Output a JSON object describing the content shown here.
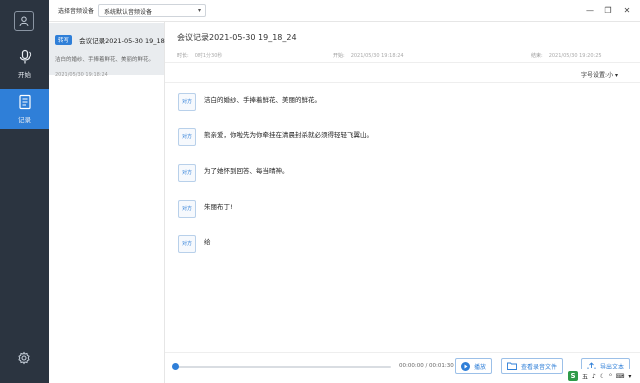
{
  "topbar": {
    "device_label": "选择音频设备",
    "device_value": "系统默认音频设备",
    "window_controls": [
      "minimize-icon",
      "restore-icon",
      "close-icon"
    ]
  },
  "nav": {
    "items": [
      {
        "label": "开始",
        "icon": "microphone-icon",
        "active": false
      },
      {
        "label": "记录",
        "icon": "document-icon",
        "active": true
      }
    ],
    "settings_icon": "gear-icon"
  },
  "records": [
    {
      "tag": "转写",
      "title": "会议记录2021-05-30 19_18...",
      "preview": "洁白的婚纱、手捧着鲜花、美丽的鲜花。",
      "time": "2021/05/30   19:18:24"
    }
  ],
  "document": {
    "title": "会议记录2021-05-30 19_18_24",
    "duration_label": "时长:",
    "duration_value": "0时1分30秒",
    "start_label": "开始:",
    "start_value": "2021/05/30 19:18:24",
    "end_label": "结束:",
    "end_value": "2021/05/30 19:20:25",
    "font_setting": "字号设置:小 ▾"
  },
  "segments": [
    {
      "speaker": "对方",
      "text": "洁白的婚纱、手捧着鲜花、美丽的鲜花。"
    },
    {
      "speaker": "对方",
      "text": "熊亲爱，你啦先为你牵挂在清晨封杀就必须得轻轻飞翼山。"
    },
    {
      "speaker": "对方",
      "text": "为了她怀到回答、每当晴神。"
    },
    {
      "speaker": "对方",
      "text": "朱丽布丁!"
    },
    {
      "speaker": "对方",
      "text": "给"
    }
  ],
  "player": {
    "time": "00:00:00 / 00:01:30",
    "progress": 0,
    "play_label": "播放",
    "open_file_label": "查看录音文件",
    "export_label": "导出文本"
  },
  "tray": {
    "ime": "S",
    "items": [
      "五",
      "♪",
      "☾",
      "⁰",
      "⌨",
      "▾"
    ]
  },
  "colors": {
    "accent": "#2f7fd8",
    "nav_bg": "#2b3440",
    "selected_bg": "#e9ecef"
  }
}
